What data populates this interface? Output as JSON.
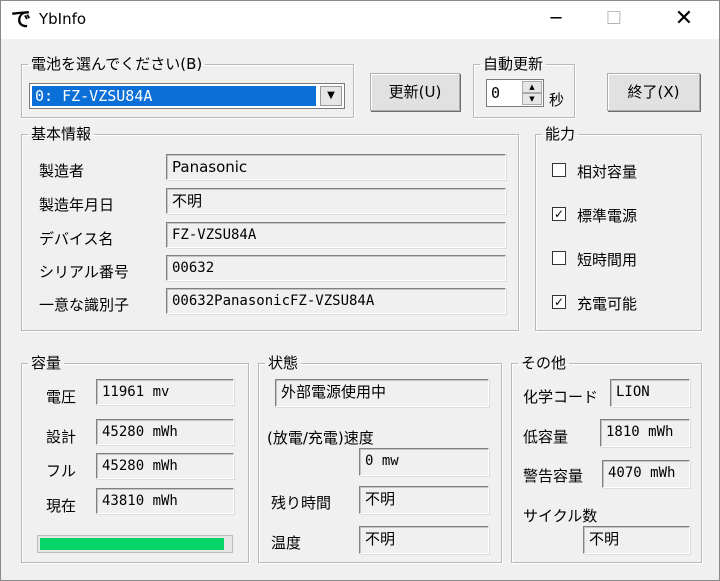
{
  "window": {
    "title": "YbInfo",
    "icon_glyph": "で",
    "minimize_glyph": "─",
    "maximize_glyph": "☐",
    "close_glyph": "✕"
  },
  "battery_select": {
    "group_label": "電池を選んでください(B)",
    "selected": "0: FZ-VZSU84A",
    "arrow_glyph": "▼"
  },
  "refresh_button": {
    "label": "更新(U)"
  },
  "auto_refresh": {
    "group_label": "自動更新",
    "value": "0",
    "unit": "秒",
    "up_glyph": "▲",
    "down_glyph": "▼"
  },
  "exit_button": {
    "label": "終了(X)"
  },
  "basic_info": {
    "group_label": "基本情報",
    "rows": [
      {
        "label": "製造者",
        "value": "Panasonic"
      },
      {
        "label": "製造年月日",
        "value": "不明"
      },
      {
        "label": "デバイス名",
        "value": "FZ-VZSU84A"
      },
      {
        "label": "シリアル番号",
        "value": "00632"
      },
      {
        "label": "一意な識別子",
        "value": "00632PanasonicFZ-VZSU84A"
      }
    ]
  },
  "capability": {
    "group_label": "能力",
    "items": [
      {
        "label": "相対容量",
        "checked": false,
        "mark": ""
      },
      {
        "label": "標準電源",
        "checked": true,
        "mark": "✓"
      },
      {
        "label": "短時間用",
        "checked": false,
        "mark": ""
      },
      {
        "label": "充電可能",
        "checked": true,
        "mark": "✓"
      }
    ]
  },
  "capacity": {
    "group_label": "容量",
    "rows": [
      {
        "label": "電圧",
        "value": "11961 mv"
      },
      {
        "label": "設計",
        "value": "45280 mWh"
      },
      {
        "label": "フル",
        "value": "45280 mWh"
      },
      {
        "label": "現在",
        "value": "43810 mWh"
      }
    ],
    "charge_level": 0.967,
    "bar_color": "#06d66a"
  },
  "status": {
    "group_label": "状態",
    "state_value": "外部電源使用中",
    "rate_label": "(放電/充電)速度",
    "rate_value": "0 mw",
    "remaining_label": "残り時間",
    "remaining_value": "不明",
    "temp_label": "温度",
    "temp_value": "不明"
  },
  "other": {
    "group_label": "その他",
    "chemistry_label": "化学コード",
    "chemistry_value": "LION",
    "low_label": "低容量",
    "low_value": "1810 mWh",
    "warning_label": "警告容量",
    "warning_value": "4070 mWh",
    "cycle_label": "サイクル数",
    "cycle_value": "不明"
  }
}
